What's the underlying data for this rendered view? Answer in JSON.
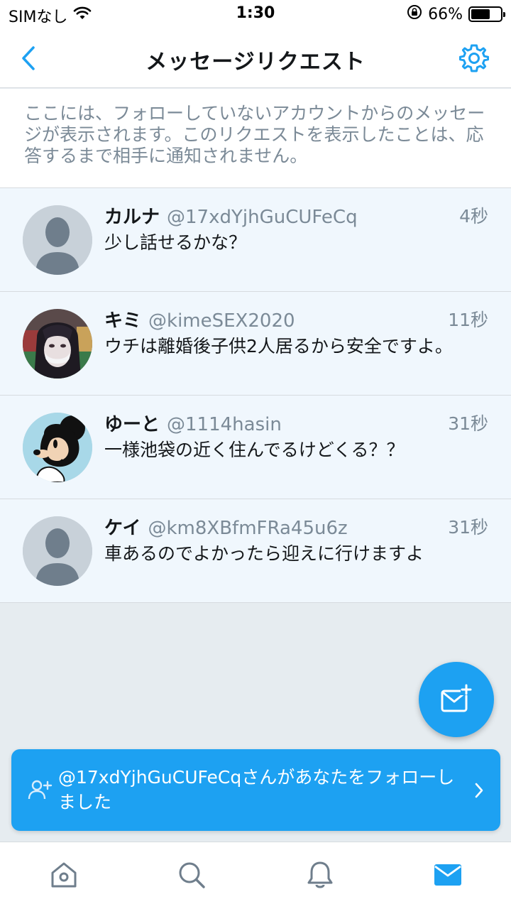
{
  "status_bar": {
    "carrier": "SIMなし",
    "time": "1:30",
    "battery_percent": "66%",
    "battery_level": 0.66
  },
  "header": {
    "title": "メッセージリクエスト"
  },
  "info": {
    "text": "ここには、フォローしていないアカウントからのメッセージが表示されます。このリクエストを表示したことは、応答するまで相手に通知されません。"
  },
  "requests": [
    {
      "name": "カルナ",
      "handle": "@17xdYjhGuCUFeCq",
      "time": "4秒",
      "message": "少し話せるかな？",
      "avatar": "default-avatar"
    },
    {
      "name": "キミ",
      "handle": "@kimeSEX2020",
      "time": "11秒",
      "message": "ウチは離婚後子供2人居るから安全ですよ。",
      "avatar": "photo-avatar"
    },
    {
      "name": "ゆーと",
      "handle": "@1114hasin",
      "time": "31秒",
      "message": "一様池袋の近く住んでるけどくる？？",
      "avatar": "cartoon-avatar"
    },
    {
      "name": "ケイ",
      "handle": "@km8XBfmFRa45u6z",
      "time": "31秒",
      "message": "車あるのでよかったら迎えに行けますよ",
      "avatar": "default-avatar"
    }
  ],
  "toast": {
    "text": "@17xdYjhGuCUFeCqさんがあなたをフォローしました"
  },
  "colors": {
    "accent": "#1da1f2",
    "row_background": "#f0f7fd",
    "page_background": "#e6ecf0",
    "secondary_text": "#7b8a97"
  },
  "icons": {
    "back": "chevron-left-icon",
    "settings": "gear-icon",
    "compose": "new-message-icon",
    "toast": "follow-icon",
    "toast_arrow": "chevron-right-icon",
    "tabs": [
      "home-icon",
      "search-icon",
      "bell-icon",
      "mail-icon"
    ]
  }
}
